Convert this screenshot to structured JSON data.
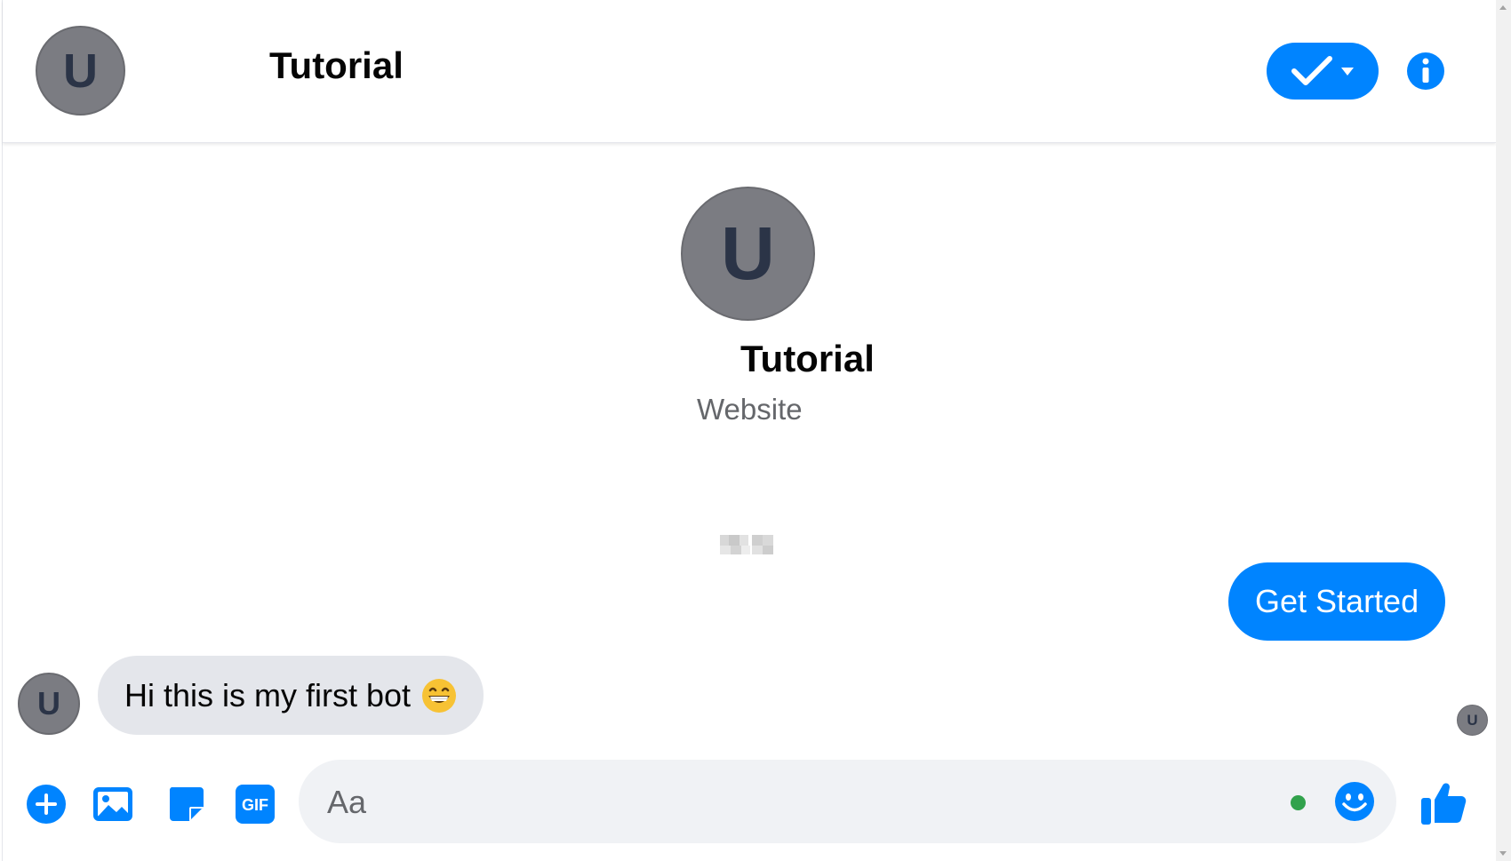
{
  "colors": {
    "accent": "#0084ff",
    "avatar_bg": "#7b7c82",
    "avatar_letter": "#2b3447",
    "incoming_bubble": "#e4e6eb",
    "input_bg": "#f0f2f5",
    "online": "#31a24c"
  },
  "header": {
    "avatar_letter": "U",
    "title": "Tutorial",
    "status_icon": "check-icon",
    "status_dropdown_icon": "caret-down-icon",
    "info_icon": "info-icon"
  },
  "profile": {
    "avatar_letter": "U",
    "name": "Tutorial",
    "subtitle": "Website"
  },
  "messages": [
    {
      "direction": "outgoing",
      "text": "Get Started"
    },
    {
      "direction": "incoming",
      "sender_avatar_letter": "U",
      "text": "Hi this is my first bot",
      "emoji": "grinning-face-emoji"
    }
  ],
  "seen_indicator": {
    "avatar_letter": "U"
  },
  "composer": {
    "tools": [
      "plus-icon",
      "photo-icon",
      "sticker-icon",
      "gif-icon"
    ],
    "gif_label": "GIF",
    "placeholder": "Aa",
    "emoji_icon": "smiley-icon",
    "like_icon": "thumbs-up-icon"
  }
}
